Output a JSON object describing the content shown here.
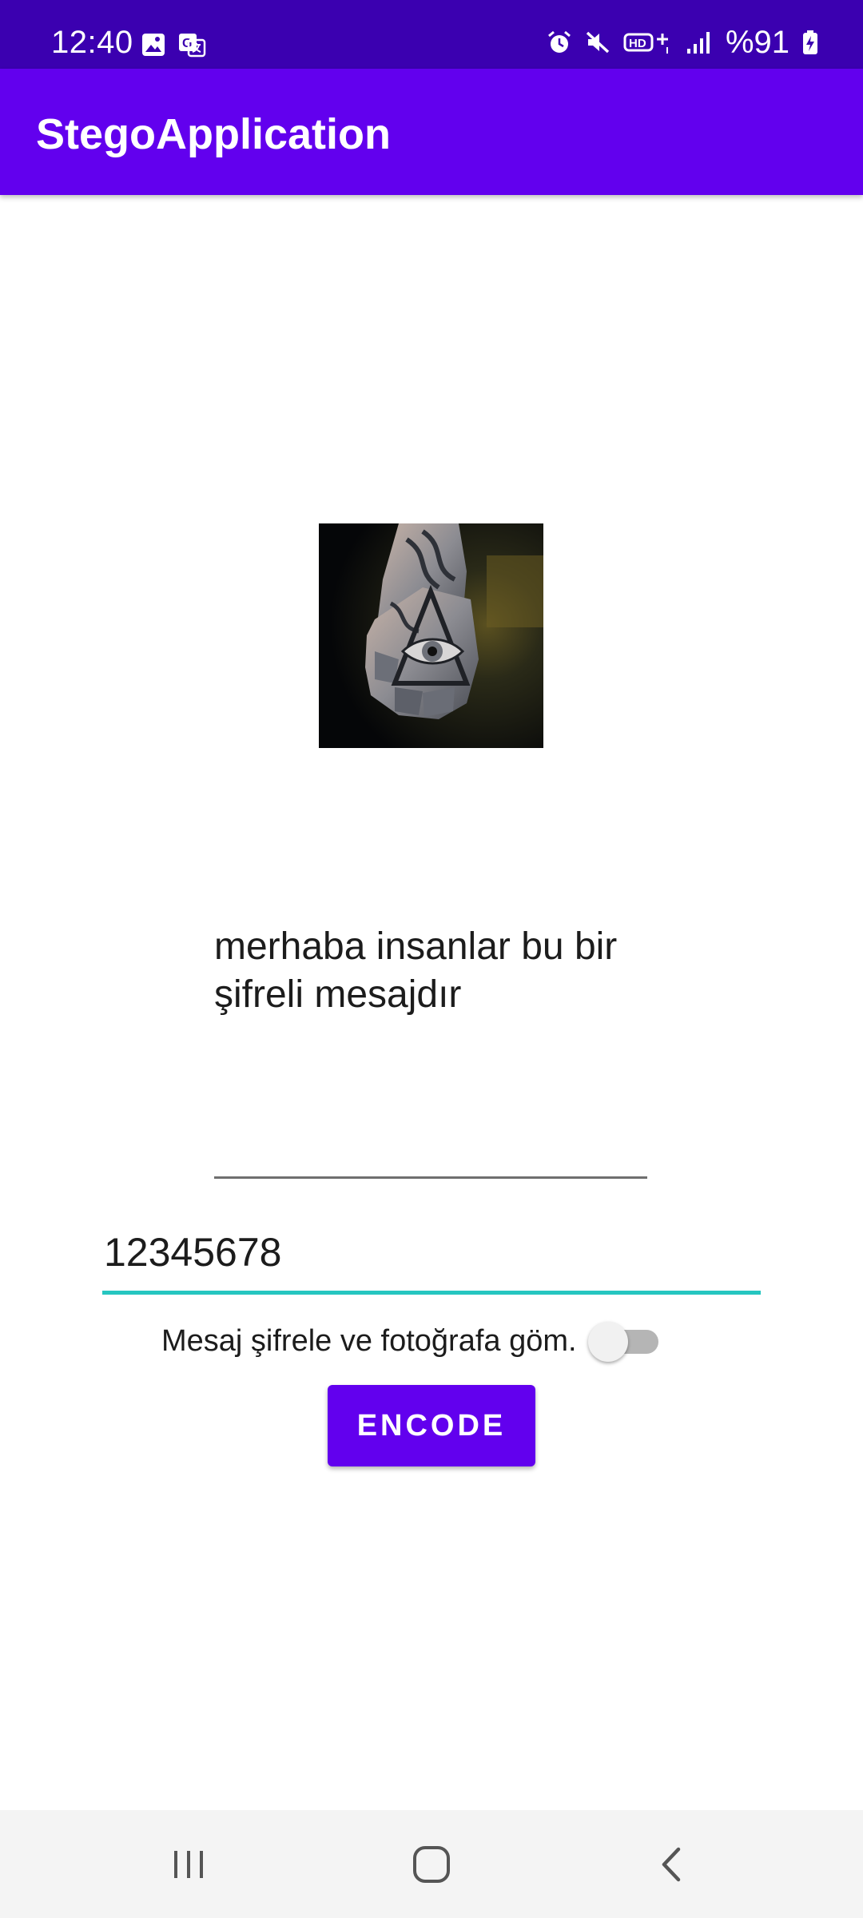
{
  "status_bar": {
    "time": "12:40",
    "battery_text": "%91",
    "icons": [
      "image-icon",
      "translate-icon",
      "alarm-icon",
      "mute-icon",
      "hd-signal-icon",
      "signal-bars-icon",
      "battery-charging-icon"
    ]
  },
  "app_bar": {
    "title": "StegoApplication"
  },
  "main": {
    "image": {
      "icon": "tattoo-photo"
    },
    "message_field": {
      "value": "merhaba insanlar bu bir şifreli mesajdır"
    },
    "password_field": {
      "value": "12345678"
    },
    "switch": {
      "label": "Mesaj şifrele ve fotoğrafa göm.",
      "checked": false
    },
    "encode_button": {
      "label": "ENCODE"
    }
  },
  "nav_bar": {
    "buttons": [
      "recents-icon",
      "home-icon",
      "back-icon"
    ]
  },
  "colors": {
    "status_bar": "#3b00b0",
    "primary": "#6200ee",
    "accent_underline": "#26c6c0",
    "switch_track": "#b5b5b5"
  }
}
